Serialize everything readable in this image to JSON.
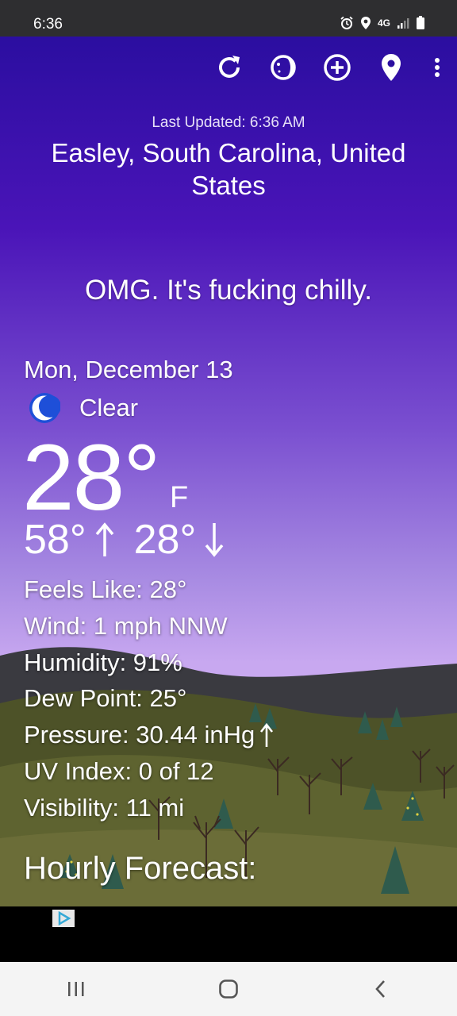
{
  "status_bar": {
    "time": "6:36",
    "network": "4G"
  },
  "toolbar": {
    "icons": [
      "refresh-icon",
      "moon-phase-icon",
      "add-location-icon",
      "location-pin-icon",
      "more-vert-icon"
    ]
  },
  "header": {
    "last_updated": "Last Updated: 6:36 AM",
    "location": "Easley, South Carolina, United States"
  },
  "tagline": "OMG. It's fucking chilly.",
  "current": {
    "date": "Mon, December 13",
    "condition": "Clear",
    "temperature": "28°",
    "unit": "F",
    "high": "58°",
    "low": "28°"
  },
  "details": {
    "feels_like": "Feels Like:  28°",
    "wind": "Wind:  1 mph NNW",
    "humidity": "Humidity:  91%",
    "dew_point": "Dew Point:  25°",
    "pressure": "Pressure:  30.44 inHg",
    "uv_index": "UV Index:  0 of 12",
    "visibility": "Visibility:  11 mi"
  },
  "hourly_title": "Hourly Forecast:",
  "colors": {
    "sky_top": "#2b0ea0",
    "sky_bottom": "#c8a8f0",
    "nav_bar": "#f4f4f4",
    "moon_icon": "#1e4fd8"
  }
}
